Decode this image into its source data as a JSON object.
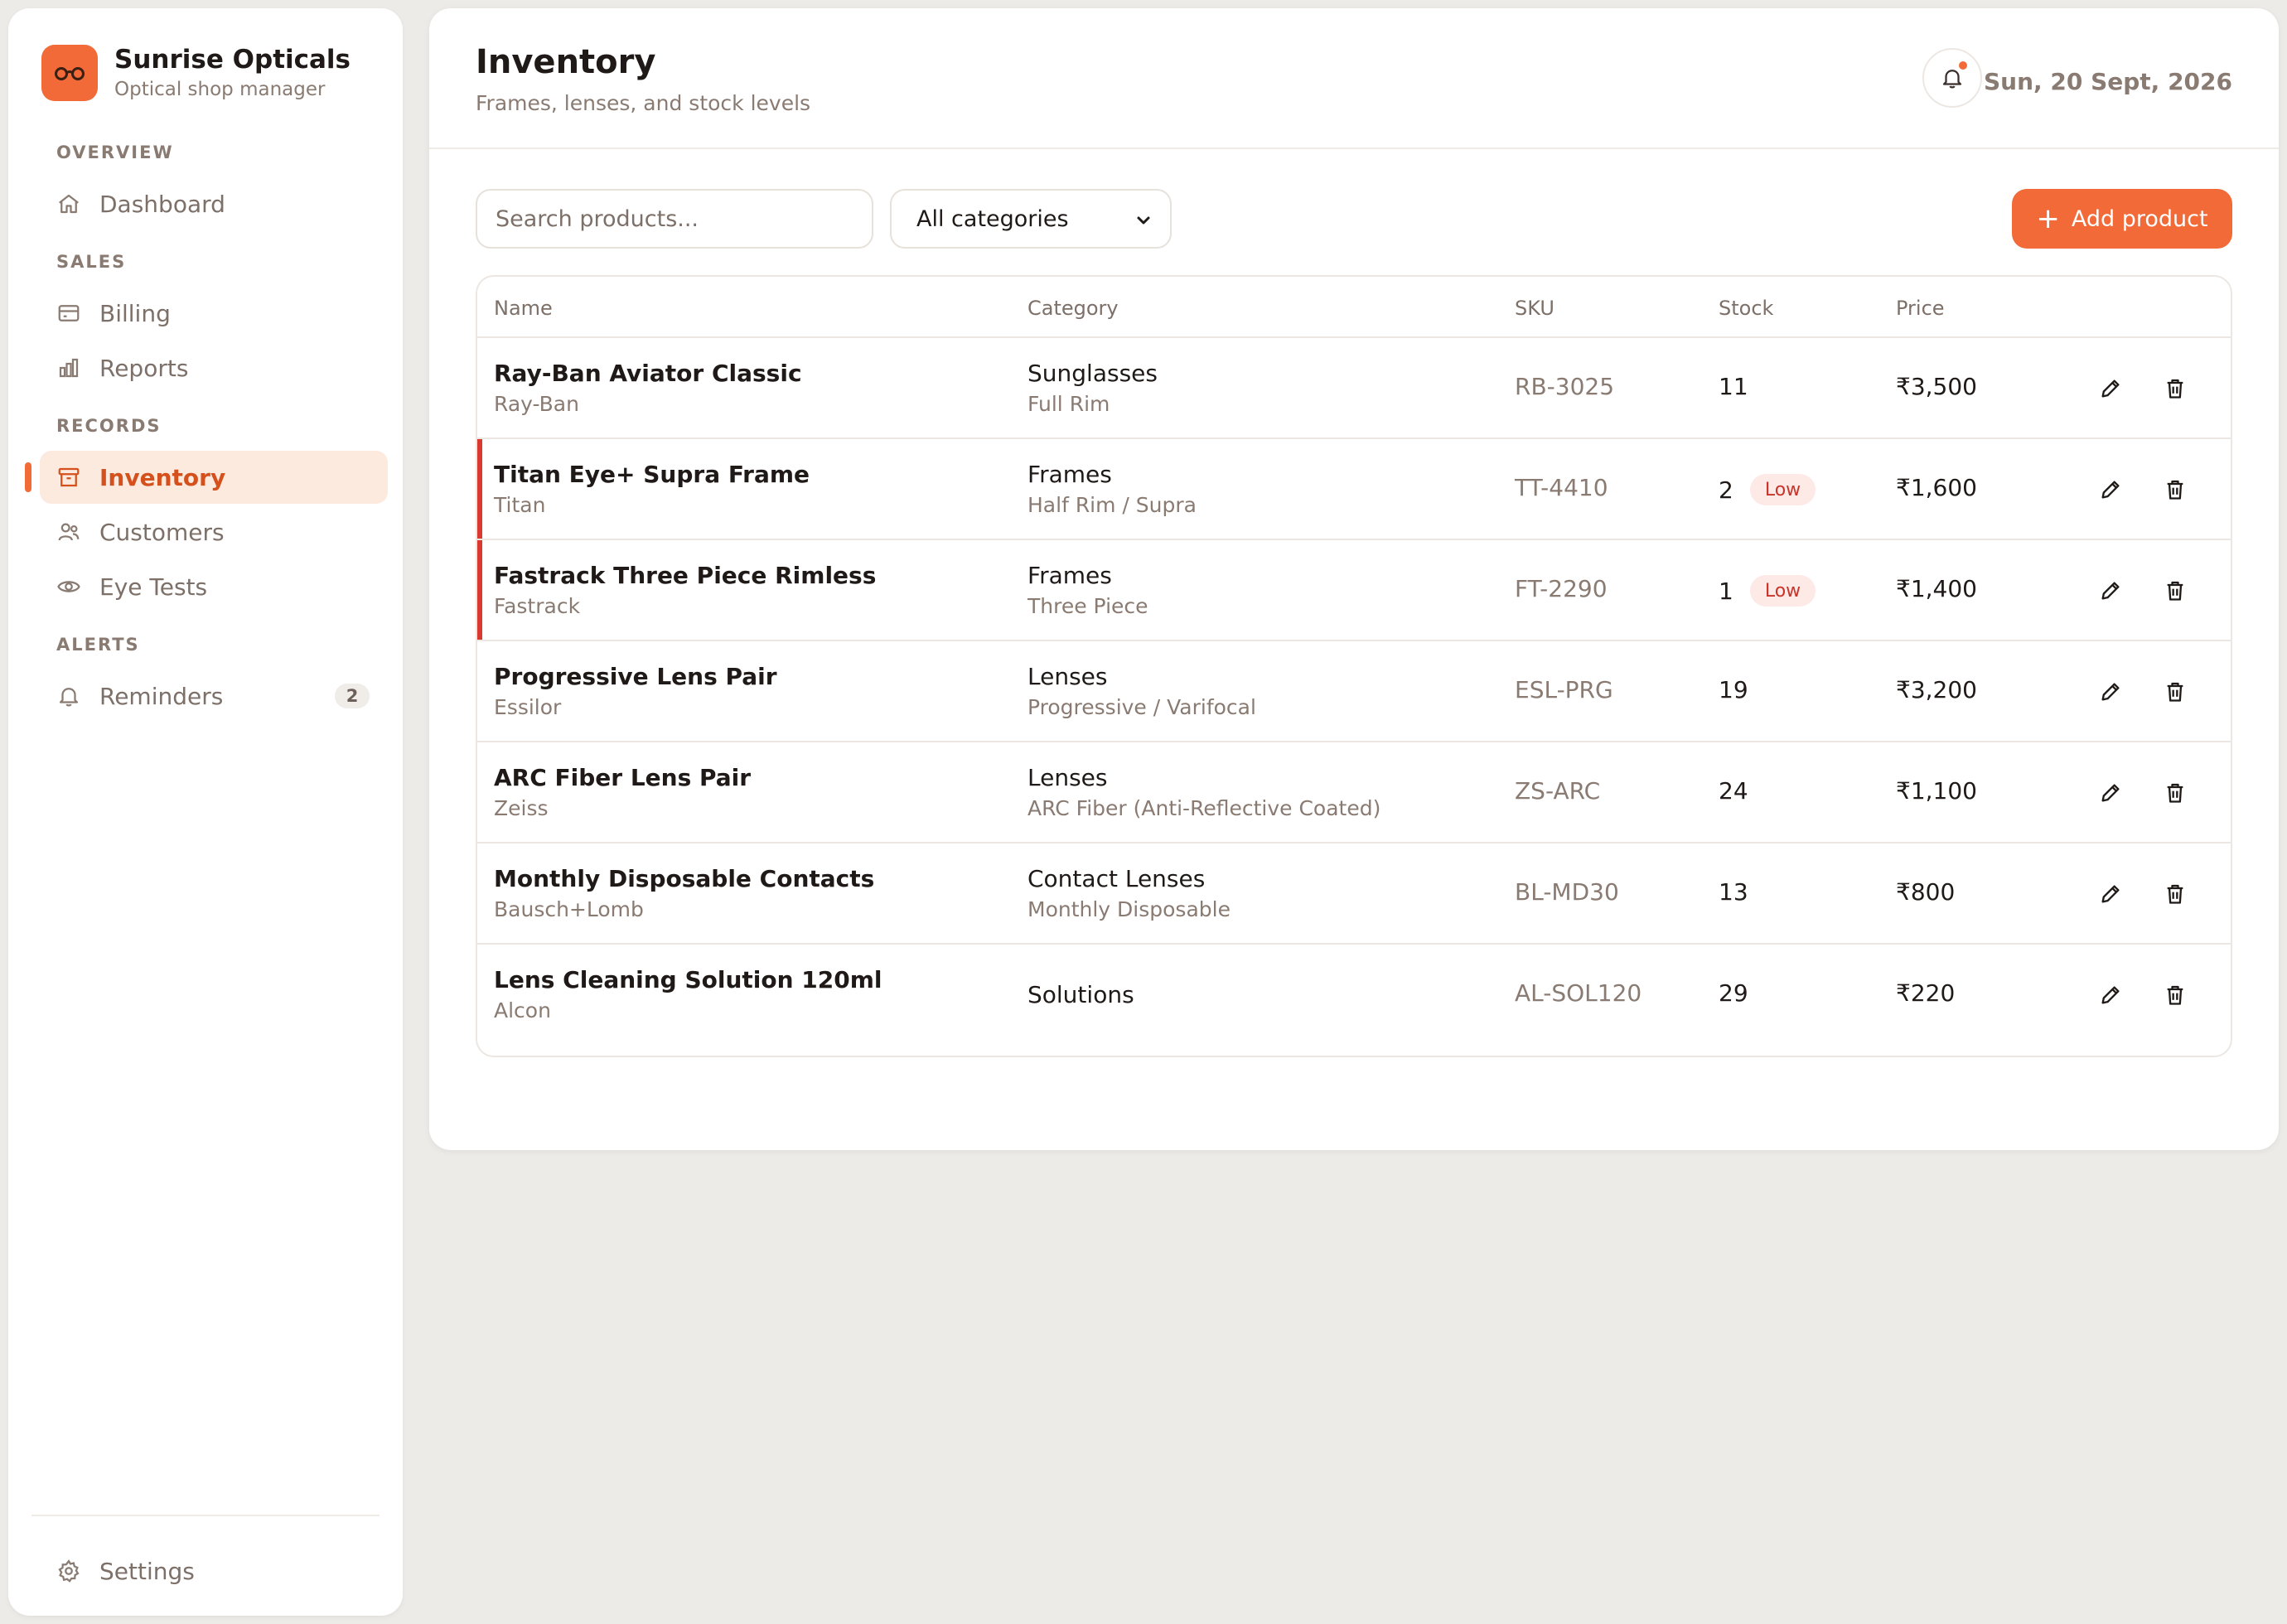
{
  "brand": {
    "name": "Sunrise Opticals",
    "subtitle": "Optical shop manager"
  },
  "nav": {
    "sections": {
      "overview": "OVERVIEW",
      "sales": "SALES",
      "records": "RECORDS",
      "alerts": "ALERTS"
    },
    "items": {
      "dashboard": "Dashboard",
      "billing": "Billing",
      "reports": "Reports",
      "inventory": "Inventory",
      "customers": "Customers",
      "eye_tests": "Eye Tests",
      "reminders": "Reminders",
      "settings": "Settings"
    },
    "reminders_count": "2",
    "active": "Inventory"
  },
  "header": {
    "title": "Inventory",
    "subtitle": "Frames, lenses, and stock levels",
    "date": "Sun, 20 Sept, 2026",
    "has_notification": true
  },
  "toolbar": {
    "search_placeholder": "Search products...",
    "category_selected": "All categories",
    "add_label": "Add product"
  },
  "table": {
    "columns": {
      "name": "Name",
      "category": "Category",
      "sku": "SKU",
      "stock": "Stock",
      "price": "Price"
    },
    "low_label": "Low",
    "rows": [
      {
        "name": "Ray-Ban Aviator Classic",
        "brand": "Ray-Ban",
        "category": "Sunglasses",
        "subcategory": "Full Rim",
        "sku": "RB-3025",
        "stock": "11",
        "low": false,
        "price": "₹3,500"
      },
      {
        "name": "Titan Eye+ Supra Frame",
        "brand": "Titan",
        "category": "Frames",
        "subcategory": "Half Rim / Supra",
        "sku": "TT-4410",
        "stock": "2",
        "low": true,
        "price": "₹1,600"
      },
      {
        "name": "Fastrack Three Piece Rimless",
        "brand": "Fastrack",
        "category": "Frames",
        "subcategory": "Three Piece",
        "sku": "FT-2290",
        "stock": "1",
        "low": true,
        "price": "₹1,400"
      },
      {
        "name": "Progressive Lens Pair",
        "brand": "Essilor",
        "category": "Lenses",
        "subcategory": "Progressive / Varifocal",
        "sku": "ESL-PRG",
        "stock": "19",
        "low": false,
        "price": "₹3,200"
      },
      {
        "name": "ARC Fiber Lens Pair",
        "brand": "Zeiss",
        "category": "Lenses",
        "subcategory": "ARC Fiber (Anti-Reflective Coated)",
        "sku": "ZS-ARC",
        "stock": "24",
        "low": false,
        "price": "₹1,100"
      },
      {
        "name": "Monthly Disposable Contacts",
        "brand": "Bausch+Lomb",
        "category": "Contact Lenses",
        "subcategory": "Monthly Disposable",
        "sku": "BL-MD30",
        "stock": "13",
        "low": false,
        "price": "₹800"
      },
      {
        "name": "Lens Cleaning Solution 120ml",
        "brand": "Alcon",
        "category": "Solutions",
        "subcategory": "",
        "sku": "AL-SOL120",
        "stock": "29",
        "low": false,
        "price": "₹220"
      }
    ]
  },
  "colors": {
    "accent": "#f26a38",
    "active_text": "#d4501d",
    "active_bg": "#fdeade",
    "low_flag": "#d93a30",
    "low_badge_bg": "#fde9e6",
    "page_bg": "#edebe7"
  },
  "icons": {
    "brand": "glasses-icon",
    "dashboard": "home-icon",
    "billing": "credit-card-icon",
    "reports": "bar-chart-icon",
    "inventory": "archive-box-icon",
    "customers": "users-icon",
    "eye_tests": "eye-icon",
    "reminders": "bell-icon",
    "settings": "gear-icon",
    "edit": "pencil-icon",
    "delete": "trash-icon"
  }
}
